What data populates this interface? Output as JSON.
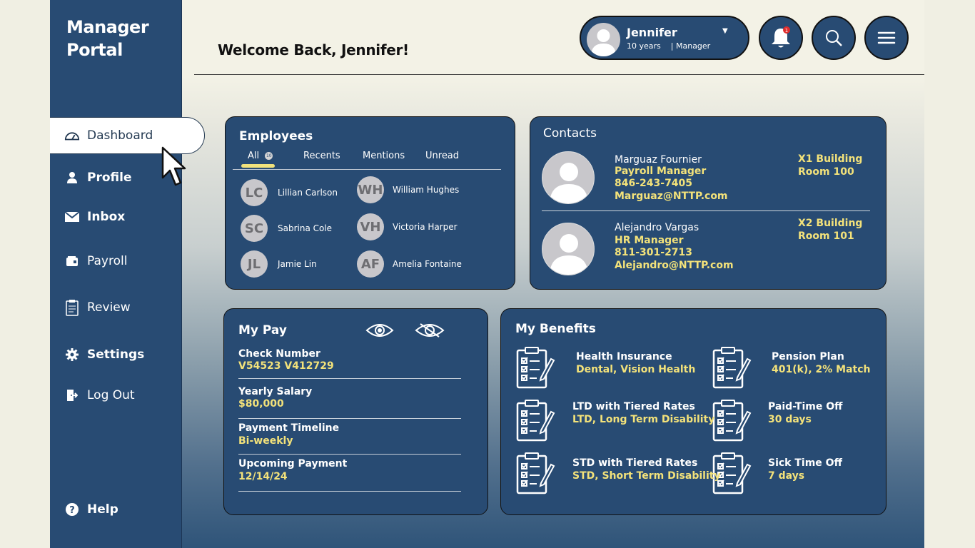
{
  "app": {
    "title_line1": "Manager",
    "title_line2": "Portal"
  },
  "header": {
    "welcome": "Welcome Back, Jennifer!"
  },
  "user": {
    "name": "Jennifer",
    "tenure": "10 years",
    "separator": "|",
    "role": "Manager",
    "notification_count": "1"
  },
  "sidebar": {
    "items": [
      {
        "label": "Dashboard",
        "icon": "gauge-icon"
      },
      {
        "label": "Profile",
        "icon": "user-icon"
      },
      {
        "label": "Inbox",
        "icon": "mail-icon"
      },
      {
        "label": "Payroll",
        "icon": "wallet-icon"
      },
      {
        "label": "Review",
        "icon": "clipboard-icon"
      },
      {
        "label": "Settings",
        "icon": "gear-icon"
      },
      {
        "label": "Log Out",
        "icon": "logout-icon"
      }
    ],
    "help": "Help"
  },
  "employees": {
    "title": "Employees",
    "tabs": [
      "All",
      "Recents",
      "Mentions",
      "Unread"
    ],
    "all_badge": "10",
    "list": [
      {
        "initials": "LC",
        "name": "Lillian Carlson"
      },
      {
        "initials": "WH",
        "name": "William Hughes"
      },
      {
        "initials": "SC",
        "name": "Sabrina Cole"
      },
      {
        "initials": "VH",
        "name": "Victoria Harper"
      },
      {
        "initials": "JL",
        "name": "Jamie Lin"
      },
      {
        "initials": "AF",
        "name": "Amelia Fontaine"
      }
    ]
  },
  "contacts": {
    "title": "Contacts",
    "list": [
      {
        "name": "Marguaz Fournier",
        "role": "Payroll Manager",
        "phone": "846-243-7405",
        "email": "Marguaz@NTTP.com",
        "building": "X1 Building",
        "room": "Room 100"
      },
      {
        "name": "Alejandro Vargas",
        "role": "HR Manager",
        "phone": "811-301-2713",
        "email": "Alejandro@NTTP.com",
        "building": "X2 Building",
        "room": "Room 101"
      }
    ]
  },
  "pay": {
    "title": "My Pay",
    "rows": [
      {
        "label": "Check Number",
        "value": "V54523  V412729"
      },
      {
        "label": "Yearly Salary",
        "value": "$80,000"
      },
      {
        "label": "Payment Timeline",
        "value": "Bi-weekly"
      },
      {
        "label": "Upcoming Payment",
        "value": "12/14/24"
      }
    ]
  },
  "benefits": {
    "title": "My Benefits",
    "items": [
      {
        "title": "Health Insurance",
        "detail": "Dental, Vision Health"
      },
      {
        "title": "Pension Plan",
        "detail": "401(k), 2% Match"
      },
      {
        "title": "LTD with Tiered Rates",
        "detail": "LTD, Long Term Disability"
      },
      {
        "title": "Paid-Time Off",
        "detail": "30 days"
      },
      {
        "title": "STD with Tiered Rates",
        "detail": "STD, Short Term Disability"
      },
      {
        "title": "Sick Time Off",
        "detail": "7 days"
      }
    ]
  },
  "colors": {
    "primary": "#284b73",
    "accent": "#f3e27a",
    "background": "#f3f2e6"
  }
}
